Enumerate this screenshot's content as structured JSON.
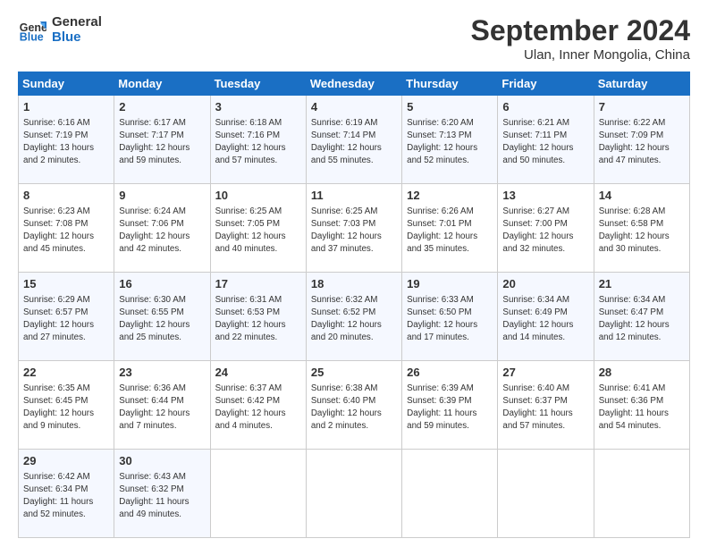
{
  "logo": {
    "line1": "General",
    "line2": "Blue"
  },
  "header": {
    "month": "September 2024",
    "location": "Ulan, Inner Mongolia, China"
  },
  "weekdays": [
    "Sunday",
    "Monday",
    "Tuesday",
    "Wednesday",
    "Thursday",
    "Friday",
    "Saturday"
  ],
  "weeks": [
    [
      {
        "day": "1",
        "info": "Sunrise: 6:16 AM\nSunset: 7:19 PM\nDaylight: 13 hours\nand 2 minutes."
      },
      {
        "day": "2",
        "info": "Sunrise: 6:17 AM\nSunset: 7:17 PM\nDaylight: 12 hours\nand 59 minutes."
      },
      {
        "day": "3",
        "info": "Sunrise: 6:18 AM\nSunset: 7:16 PM\nDaylight: 12 hours\nand 57 minutes."
      },
      {
        "day": "4",
        "info": "Sunrise: 6:19 AM\nSunset: 7:14 PM\nDaylight: 12 hours\nand 55 minutes."
      },
      {
        "day": "5",
        "info": "Sunrise: 6:20 AM\nSunset: 7:13 PM\nDaylight: 12 hours\nand 52 minutes."
      },
      {
        "day": "6",
        "info": "Sunrise: 6:21 AM\nSunset: 7:11 PM\nDaylight: 12 hours\nand 50 minutes."
      },
      {
        "day": "7",
        "info": "Sunrise: 6:22 AM\nSunset: 7:09 PM\nDaylight: 12 hours\nand 47 minutes."
      }
    ],
    [
      {
        "day": "8",
        "info": "Sunrise: 6:23 AM\nSunset: 7:08 PM\nDaylight: 12 hours\nand 45 minutes."
      },
      {
        "day": "9",
        "info": "Sunrise: 6:24 AM\nSunset: 7:06 PM\nDaylight: 12 hours\nand 42 minutes."
      },
      {
        "day": "10",
        "info": "Sunrise: 6:25 AM\nSunset: 7:05 PM\nDaylight: 12 hours\nand 40 minutes."
      },
      {
        "day": "11",
        "info": "Sunrise: 6:25 AM\nSunset: 7:03 PM\nDaylight: 12 hours\nand 37 minutes."
      },
      {
        "day": "12",
        "info": "Sunrise: 6:26 AM\nSunset: 7:01 PM\nDaylight: 12 hours\nand 35 minutes."
      },
      {
        "day": "13",
        "info": "Sunrise: 6:27 AM\nSunset: 7:00 PM\nDaylight: 12 hours\nand 32 minutes."
      },
      {
        "day": "14",
        "info": "Sunrise: 6:28 AM\nSunset: 6:58 PM\nDaylight: 12 hours\nand 30 minutes."
      }
    ],
    [
      {
        "day": "15",
        "info": "Sunrise: 6:29 AM\nSunset: 6:57 PM\nDaylight: 12 hours\nand 27 minutes."
      },
      {
        "day": "16",
        "info": "Sunrise: 6:30 AM\nSunset: 6:55 PM\nDaylight: 12 hours\nand 25 minutes."
      },
      {
        "day": "17",
        "info": "Sunrise: 6:31 AM\nSunset: 6:53 PM\nDaylight: 12 hours\nand 22 minutes."
      },
      {
        "day": "18",
        "info": "Sunrise: 6:32 AM\nSunset: 6:52 PM\nDaylight: 12 hours\nand 20 minutes."
      },
      {
        "day": "19",
        "info": "Sunrise: 6:33 AM\nSunset: 6:50 PM\nDaylight: 12 hours\nand 17 minutes."
      },
      {
        "day": "20",
        "info": "Sunrise: 6:34 AM\nSunset: 6:49 PM\nDaylight: 12 hours\nand 14 minutes."
      },
      {
        "day": "21",
        "info": "Sunrise: 6:34 AM\nSunset: 6:47 PM\nDaylight: 12 hours\nand 12 minutes."
      }
    ],
    [
      {
        "day": "22",
        "info": "Sunrise: 6:35 AM\nSunset: 6:45 PM\nDaylight: 12 hours\nand 9 minutes."
      },
      {
        "day": "23",
        "info": "Sunrise: 6:36 AM\nSunset: 6:44 PM\nDaylight: 12 hours\nand 7 minutes."
      },
      {
        "day": "24",
        "info": "Sunrise: 6:37 AM\nSunset: 6:42 PM\nDaylight: 12 hours\nand 4 minutes."
      },
      {
        "day": "25",
        "info": "Sunrise: 6:38 AM\nSunset: 6:40 PM\nDaylight: 12 hours\nand 2 minutes."
      },
      {
        "day": "26",
        "info": "Sunrise: 6:39 AM\nSunset: 6:39 PM\nDaylight: 11 hours\nand 59 minutes."
      },
      {
        "day": "27",
        "info": "Sunrise: 6:40 AM\nSunset: 6:37 PM\nDaylight: 11 hours\nand 57 minutes."
      },
      {
        "day": "28",
        "info": "Sunrise: 6:41 AM\nSunset: 6:36 PM\nDaylight: 11 hours\nand 54 minutes."
      }
    ],
    [
      {
        "day": "29",
        "info": "Sunrise: 6:42 AM\nSunset: 6:34 PM\nDaylight: 11 hours\nand 52 minutes."
      },
      {
        "day": "30",
        "info": "Sunrise: 6:43 AM\nSunset: 6:32 PM\nDaylight: 11 hours\nand 49 minutes."
      },
      null,
      null,
      null,
      null,
      null
    ]
  ]
}
